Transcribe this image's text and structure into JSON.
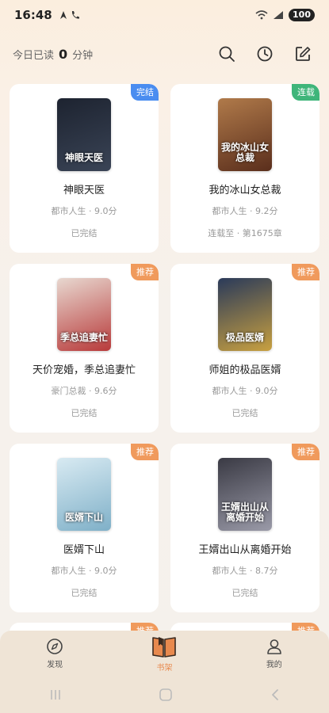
{
  "status_bar": {
    "time": "16:48",
    "battery": "100"
  },
  "header": {
    "reading_prefix": "今日已读",
    "reading_minutes": "0",
    "reading_unit": "分钟"
  },
  "books": [
    {
      "title": "神眼天医",
      "meta": "都市人生 · 9.0分",
      "status": "已完结",
      "badge": "完结",
      "badge_color": "#4a8df0",
      "cover_text": "神眼天医",
      "cover_colors": [
        "#1d2330",
        "#3a4456"
      ]
    },
    {
      "title": "我的冰山女总裁",
      "meta": "都市人生 · 9.2分",
      "status": "连载至 · 第1675章",
      "badge": "连载",
      "badge_color": "#3fb57a",
      "cover_text": "我的冰山女总裁",
      "cover_colors": [
        "#b07a4a",
        "#5a2e1c"
      ]
    },
    {
      "title": "天价宠婚，季总追妻忙",
      "meta": "豪门总裁 · 9.6分",
      "status": "已完结",
      "badge": "推荐",
      "badge_color": "#f09a5c",
      "cover_text": "季总追妻忙",
      "cover_colors": [
        "#e8d8d0",
        "#b83a3a"
      ]
    },
    {
      "title": "师姐的极品医婿",
      "meta": "都市人生 · 9.0分",
      "status": "已完结",
      "badge": "推荐",
      "badge_color": "#f09a5c",
      "cover_text": "极品医婿",
      "cover_colors": [
        "#2a3a5a",
        "#c8a040"
      ]
    },
    {
      "title": "医婿下山",
      "meta": "都市人生 · 9.0分",
      "status": "已完结",
      "badge": "推荐",
      "badge_color": "#f09a5c",
      "cover_text": "医婿下山",
      "cover_colors": [
        "#d8eaf2",
        "#7fb0c8"
      ]
    },
    {
      "title": "王婿出山从离婚开始",
      "meta": "都市人生 · 8.7分",
      "status": "已完结",
      "badge": "推荐",
      "badge_color": "#f09a5c",
      "cover_text": "王婿出山从离婚开始",
      "cover_colors": [
        "#3a3a44",
        "#9a9aa8"
      ]
    }
  ],
  "partial_badges": [
    "推荐",
    "推荐"
  ],
  "nav": [
    {
      "label": "发现",
      "icon": "compass-icon"
    },
    {
      "label": "书架",
      "icon": "book-icon"
    },
    {
      "label": "我的",
      "icon": "person-icon"
    }
  ]
}
